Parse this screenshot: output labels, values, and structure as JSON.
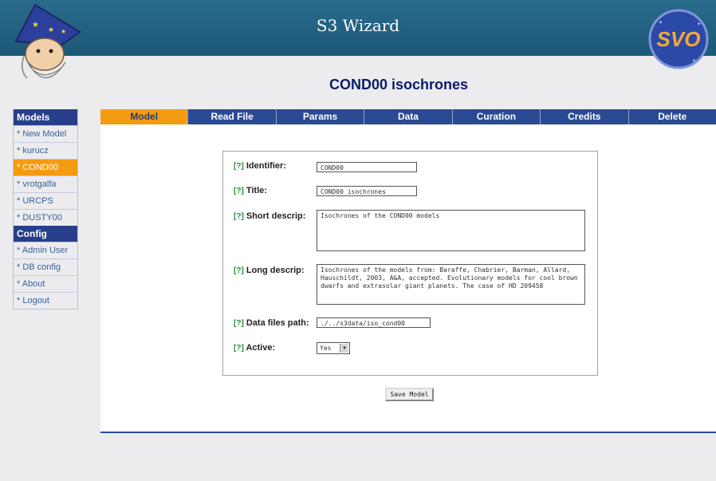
{
  "header": {
    "app_title": "S3 Wizard",
    "page_title": "COND00 isochrones",
    "logo_text": "SVO",
    "colors": {
      "bar": "#1d5878",
      "accent": "#f39c12",
      "nav": "#2a4a94"
    }
  },
  "sidebar": {
    "models_header": "Models",
    "model_items": [
      {
        "label": "* New Model",
        "active": false
      },
      {
        "label": "* kurucz",
        "active": false
      },
      {
        "label": "* COND00",
        "active": true
      },
      {
        "label": "* vrotgalfa",
        "active": false
      },
      {
        "label": "* URCPS",
        "active": false
      },
      {
        "label": "* DUSTY00",
        "active": false
      }
    ],
    "config_header": "Config",
    "config_items": [
      {
        "label": "* Admin User"
      },
      {
        "label": "* DB config"
      },
      {
        "label": "* About"
      },
      {
        "label": "* Logout"
      }
    ]
  },
  "tabs": [
    "Model",
    "Read File",
    "Params",
    "Data",
    "Curation",
    "Credits",
    "Delete"
  ],
  "active_tab": "Model",
  "form": {
    "help_marker": "[?]",
    "identifier_label": "Identifier:",
    "identifier_value": "COND00",
    "title_label": "Title:",
    "title_value": "COND00 isochrones",
    "short_label": "Short descrip:",
    "short_value": "Isochrones of the COND00 models",
    "long_label": "Long descrip:",
    "long_value": "Isochrones of the models from: Baraffe, Chabrier, Barman, Allard, Hauschildt, 2003, A&A, accepted. Evolutionary models for cool brown dwarfs and extrasolar giant planets. The case of HD 209458",
    "path_label": "Data files path:",
    "path_value": "./../s3data/iso_cond00",
    "active_label": "Active:",
    "active_value": "Yes",
    "save_label": "Save Model"
  }
}
